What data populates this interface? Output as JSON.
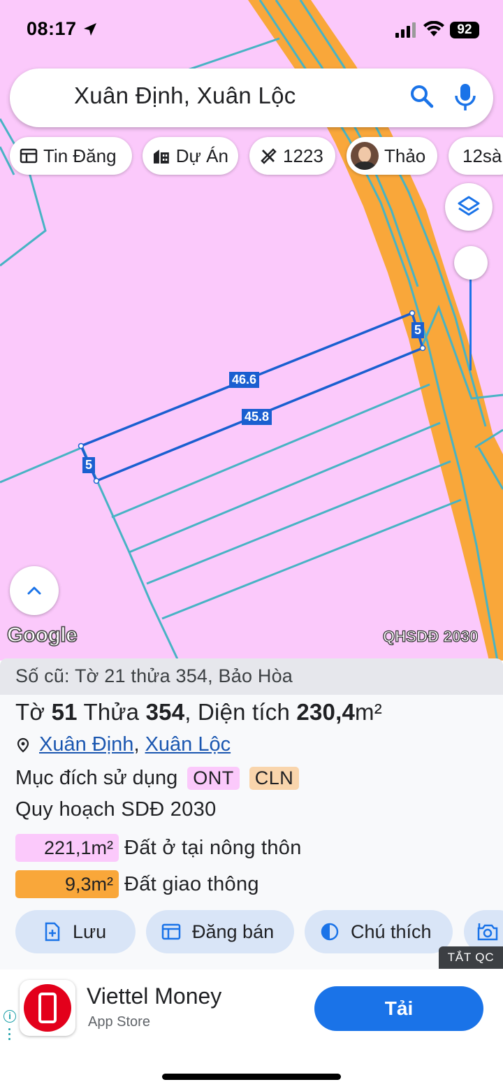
{
  "status_bar": {
    "time": "08:17",
    "battery": "92"
  },
  "search": {
    "query": "Xuân Định, Xuân Lộc"
  },
  "chips": [
    {
      "label": "Tin Đăng",
      "icon": "newspaper-icon"
    },
    {
      "label": "Dự Án",
      "icon": "buildings-icon"
    },
    {
      "label": "1223",
      "icon": "ruler-pencil-icon"
    },
    {
      "label": "Thảo",
      "icon": "avatar"
    },
    {
      "label": "12sà",
      "icon": ""
    }
  ],
  "map": {
    "google_label": "Google",
    "layer_badge": "QHSDĐ 2030",
    "dimensions": {
      "top_edge": "46.6",
      "bottom_edge": "45.8",
      "right_edge": "5",
      "left_edge": "5"
    },
    "colors": {
      "land": "#fbc9fb",
      "road": "#f9a73a",
      "boundary": "#48b3c4",
      "selected": "#1a5fd0"
    }
  },
  "panel": {
    "old_number": "Số cũ: Tờ 21 thửa 354, Bảo Hòa",
    "title_prefix": "Tờ",
    "sheet": "51",
    "title_mid": "Thửa",
    "parcel": "354",
    "title_area_label": ", Diện tích",
    "area": "230,4m²",
    "address_commune": "Xuân Định",
    "address_district": "Xuân Lộc",
    "purpose_label": "Mục đích sử dụng",
    "purpose_codes": [
      "ONT",
      "CLN"
    ],
    "plan_title": "Quy hoạch SDĐ 2030",
    "plan_items": [
      {
        "area": "221,1m²",
        "label": "Đất ở tại nông thôn",
        "color": "#fbc9fb"
      },
      {
        "area": "9,3m²",
        "label": "Đất giao thông",
        "color": "#f9a73a"
      }
    ],
    "actions": [
      {
        "label": "Lưu",
        "icon": "add-file-icon"
      },
      {
        "label": "Đăng bán",
        "icon": "listing-icon"
      },
      {
        "label": "Chú thích",
        "icon": "contrast-icon"
      },
      {
        "label": "",
        "icon": "add-photo-icon"
      }
    ],
    "ad_close": "TẮT QC"
  },
  "ad": {
    "app_name": "Viettel Money",
    "store": "App Store",
    "cta": "Tải"
  }
}
